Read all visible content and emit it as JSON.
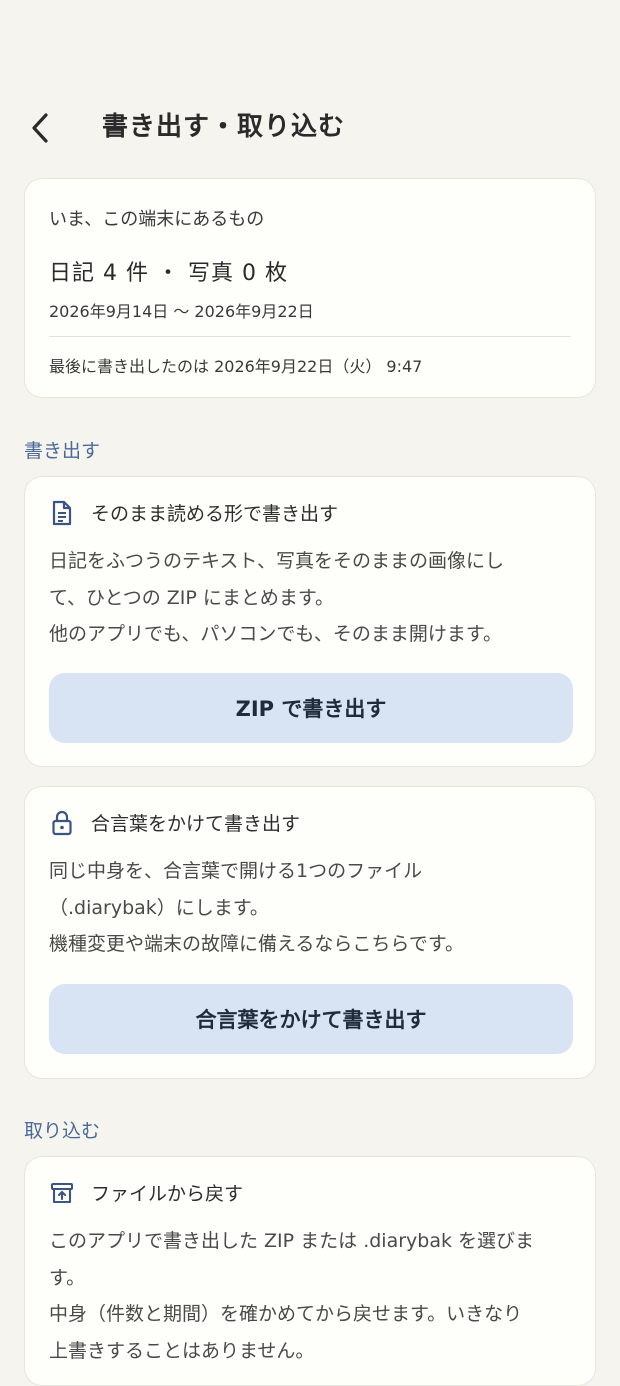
{
  "header": {
    "title": "書き出す・取り込む"
  },
  "summary": {
    "label": "いま、この端末にあるもの",
    "counts": "日記 4 件 ・ 写真 0 枚",
    "range": "2026年9月14日 〜 2026年9月22日",
    "last_export": "最後に書き出したのは 2026年9月22日（火） 9:47"
  },
  "export_section": {
    "heading": "書き出す",
    "zip": {
      "title": "そのまま読める形で書き出す",
      "line1": "日記をふつうのテキスト、写真をそのままの画像にし",
      "line2": "て、ひとつの ZIP にまとめます。",
      "line3": "他のアプリでも、パソコンでも、そのまま開けます。",
      "button": "ZIP で書き出す"
    },
    "encrypted": {
      "title": "合言葉をかけて書き出す",
      "line1": "同じ中身を、合言葉で開ける1つのファイル",
      "line2": "（.diarybak）にします。",
      "line3": "機種変更や端末の故障に備えるならこちらです。",
      "button": "合言葉をかけて書き出す"
    }
  },
  "import_section": {
    "heading": "取り込む",
    "restore": {
      "title": "ファイルから戻す",
      "line1": "このアプリで書き出した ZIP または .diarybak を選びま",
      "line2": "す。",
      "line3": "中身（件数と期間）を確かめてから戻せます。いきなり",
      "line4": "上書きすることはありません。"
    }
  },
  "colors": {
    "background": "#f6f4ee",
    "card": "#fefefb",
    "accent_text": "#4a6a9a",
    "button_bg": "#d8e3f4",
    "icon": "#3b5580"
  },
  "icons": {
    "back": "chevron-left-icon",
    "zip": "document-icon",
    "encrypted": "lock-icon",
    "restore": "archive-upload-icon"
  }
}
